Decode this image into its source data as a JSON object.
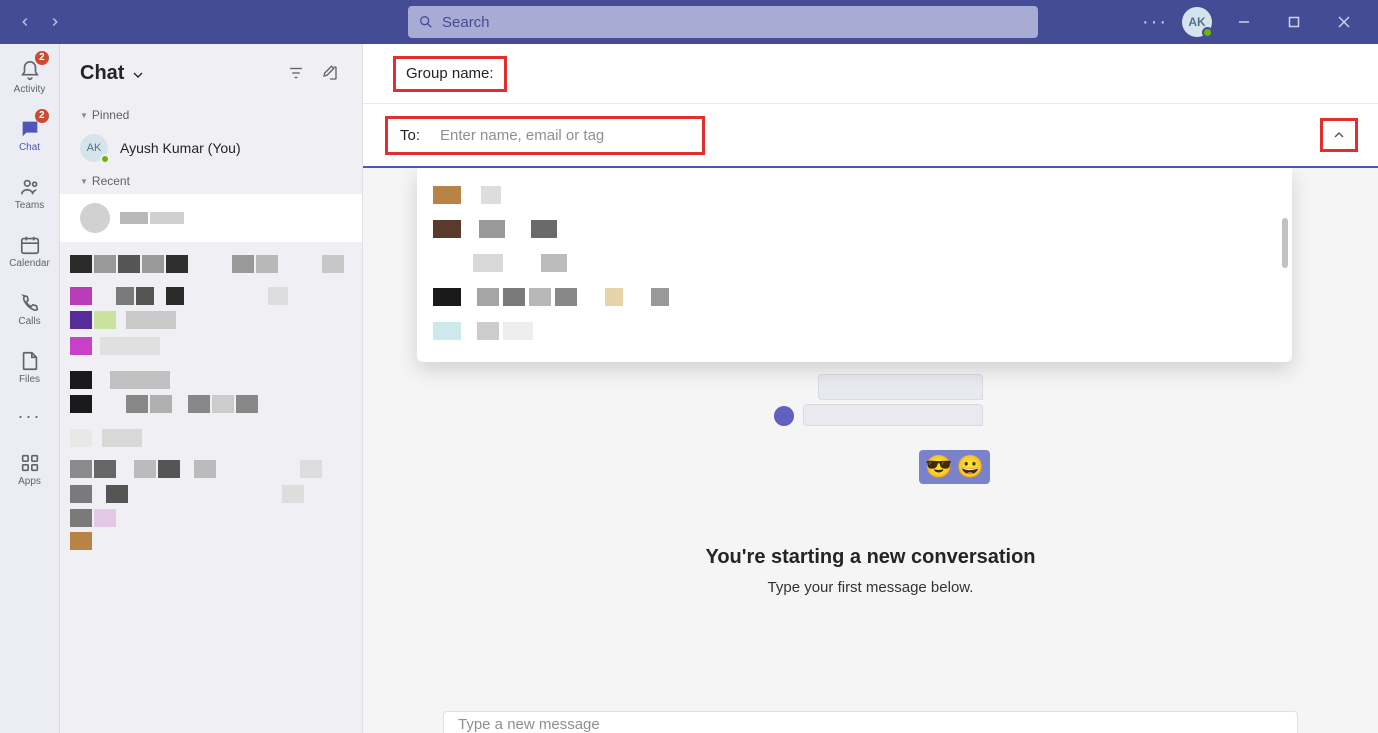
{
  "titlebar": {
    "search_placeholder": "Search",
    "avatar_initials": "AK"
  },
  "rail": {
    "activity": "Activity",
    "activity_badge": "2",
    "chat": "Chat",
    "chat_badge": "2",
    "teams": "Teams",
    "calendar": "Calendar",
    "calls": "Calls",
    "files": "Files",
    "apps": "Apps"
  },
  "chatlist": {
    "title": "Chat",
    "pinned_label": "Pinned",
    "recent_label": "Recent",
    "self_name": "Ayush Kumar (You)",
    "self_initials": "AK"
  },
  "newchat": {
    "group_label": "Group name:",
    "to_label": "To:",
    "to_placeholder": "Enter name, email or tag",
    "start_heading": "You're starting a new conversation",
    "start_sub": "Type your first message below.",
    "compose_placeholder": "Type a new message"
  },
  "emoji": {
    "a": "😎",
    "b": "😀"
  }
}
